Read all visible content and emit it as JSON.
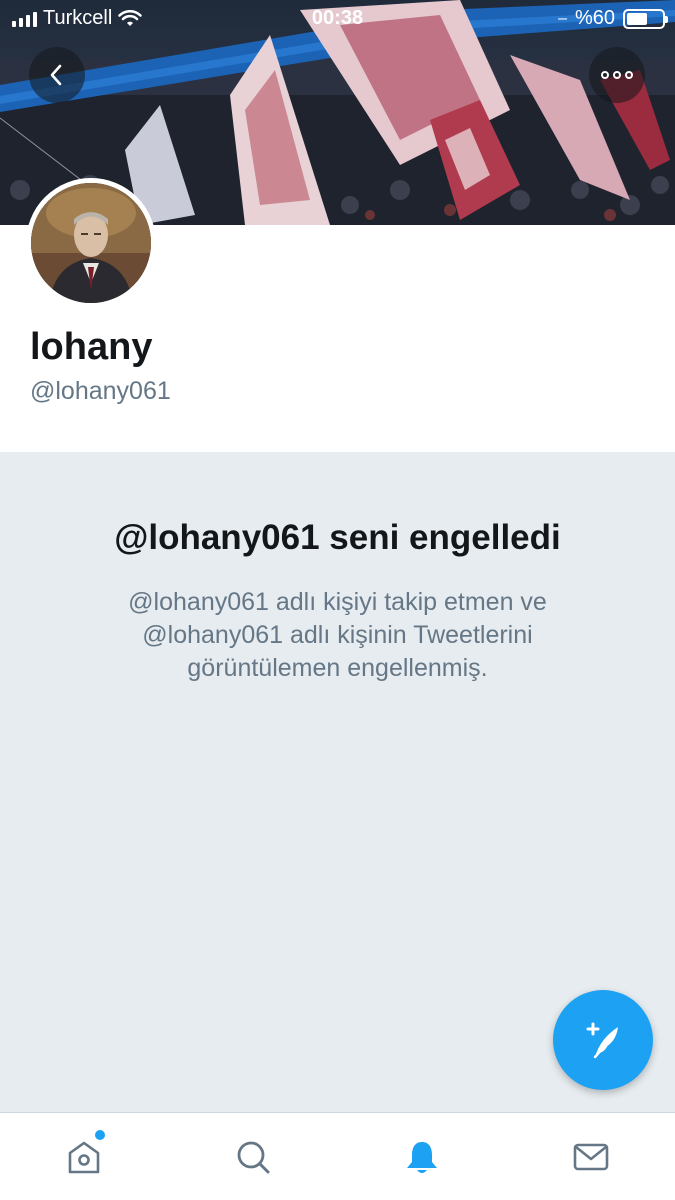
{
  "status_bar": {
    "carrier": "Turkcell",
    "time": "00:38",
    "battery_text": "%60",
    "battery_level": 0.6
  },
  "profile": {
    "name": "lohany",
    "handle": "@lohany061"
  },
  "blocked": {
    "title": "@lohany061 seni engelledi",
    "description": "@lohany061 adlı kişiyi takip etmen ve @lohany061 adlı kişinin Tweetlerini görüntülemen engellenmiş."
  },
  "icons": {
    "back": "chevron-left-icon",
    "more": "more-options-icon",
    "compose": "compose-tweet-icon",
    "home": "home-icon",
    "search": "search-icon",
    "notifications": "bell-icon",
    "messages": "envelope-icon"
  },
  "tabs": {
    "active": "notifications",
    "home_has_new": true
  },
  "colors": {
    "accent": "#1da1f2",
    "panel_bg": "#e6ecf0",
    "muted_text": "#657786",
    "primary_text": "#14171a",
    "icon_gray": "#657786"
  }
}
